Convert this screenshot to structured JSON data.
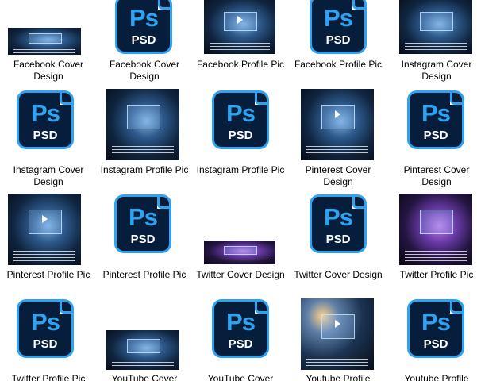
{
  "tiles": [
    {
      "label": "Facebook Cover Design"
    },
    {
      "label": "Facebook Cover Design"
    },
    {
      "label": "Facebook Profile Pic"
    },
    {
      "label": "Facebook Profile Pic"
    },
    {
      "label": "Instagram Cover Design"
    },
    {
      "label": "Instagram Cover Design"
    },
    {
      "label": "Instagram Profile Pic"
    },
    {
      "label": "Instagram Profile Pic"
    },
    {
      "label": "Pinterest Cover Design"
    },
    {
      "label": "Pinterest Cover Design"
    },
    {
      "label": "Pinterest Profile Pic"
    },
    {
      "label": "Pinterest Profile Pic"
    },
    {
      "label": "Twitter Cover Design"
    },
    {
      "label": "Twitter Cover Design"
    },
    {
      "label": "Twitter Profile Pic"
    },
    {
      "label": "Twitter Profile Pic"
    },
    {
      "label": "YouTube Cover"
    },
    {
      "label": "YouTube Cover"
    },
    {
      "label": "Youtube Profile"
    },
    {
      "label": "Youtube Profile"
    }
  ],
  "psd_icon": {
    "brand": "Ps",
    "extension": "PSD"
  }
}
